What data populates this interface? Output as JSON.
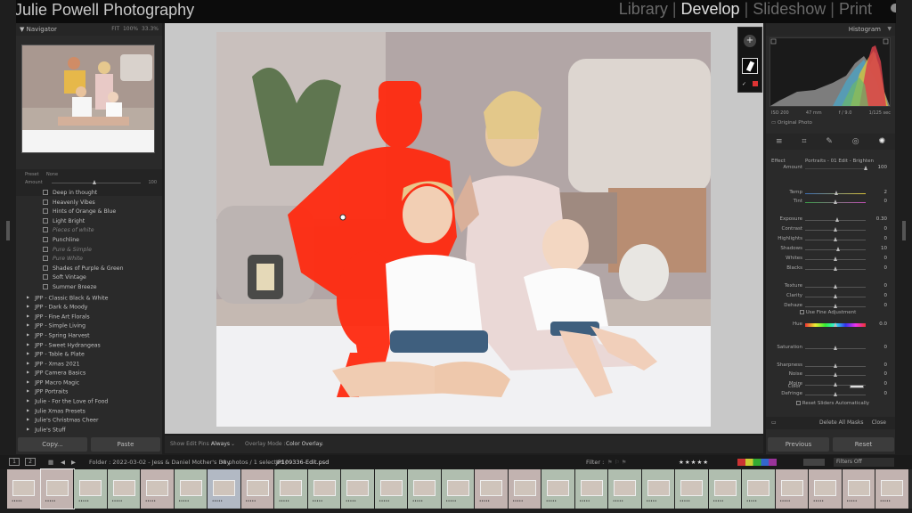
{
  "identity_plate": "Julie Powell Photography",
  "modules": [
    "Library",
    "Develop",
    "Slideshow",
    "Print"
  ],
  "active_module": "Develop",
  "navigator": {
    "title": "Navigator",
    "zoom": [
      "FIT",
      "100%",
      "33.3%"
    ]
  },
  "presets": {
    "header": [
      "Preset",
      "None"
    ],
    "amount_label": "Amount",
    "amount_value": "100",
    "items": [
      {
        "label": "Deep in thought",
        "type": "item"
      },
      {
        "label": "Heavenly Vibes",
        "type": "item"
      },
      {
        "label": "Hints of Orange & Blue",
        "type": "item"
      },
      {
        "label": "Light Bright",
        "type": "item"
      },
      {
        "label": "Pieces of white",
        "type": "item-it"
      },
      {
        "label": "Punchline",
        "type": "item"
      },
      {
        "label": "Pure & Simple",
        "type": "item-it"
      },
      {
        "label": "Pure White",
        "type": "item-it"
      },
      {
        "label": "Shades of Purple & Green",
        "type": "item"
      },
      {
        "label": "Soft Vintage",
        "type": "item"
      },
      {
        "label": "Summer Breeze",
        "type": "item"
      },
      {
        "label": "JPP - Classic Black & White",
        "type": "folder"
      },
      {
        "label": "JPP - Dark & Moody",
        "type": "folder"
      },
      {
        "label": "JPP - Fine Art Florals",
        "type": "folder"
      },
      {
        "label": "JPP - Simple Living",
        "type": "folder"
      },
      {
        "label": "JPP - Spring Harvest",
        "type": "folder"
      },
      {
        "label": "JPP - Sweet Hydrangeas",
        "type": "folder"
      },
      {
        "label": "JPP - Table & Plate",
        "type": "folder"
      },
      {
        "label": "JPP - Xmas 2021",
        "type": "folder"
      },
      {
        "label": "JPP Camera Basics",
        "type": "folder"
      },
      {
        "label": "JPP Macro Magic",
        "type": "folder"
      },
      {
        "label": "JPP Portraits",
        "type": "folder"
      },
      {
        "label": "Julie - For the Love of Food",
        "type": "folder"
      },
      {
        "label": "Julie Xmas Presets",
        "type": "folder"
      },
      {
        "label": "Julie's Christmas Cheer",
        "type": "folder"
      },
      {
        "label": "Julie's Stuff",
        "type": "folder"
      }
    ]
  },
  "left_buttons": {
    "copy": "Copy...",
    "paste": "Paste"
  },
  "toolbar": {
    "show_edit_pins_label": "Show Edit Pins :",
    "show_edit_pins_value": "Always",
    "overlay_mode_label": "Overlay Mode :",
    "overlay_mode_value": "Color Overlay"
  },
  "histogram": {
    "title": "Histogram",
    "info": [
      "ISO 200",
      "47 mm",
      "f / 9.0",
      "1/125 sec"
    ],
    "original_photo": "Original Photo"
  },
  "mask_panel": {
    "effect_label": "Effect",
    "effect_value": "Portraits - 01 Edit - Brighten",
    "sliders": [
      {
        "label": "Amount",
        "value": "100",
        "pos": 1.0
      },
      {
        "label": "Temp",
        "value": "2",
        "pos": 0.52
      },
      {
        "label": "Tint",
        "value": "0",
        "pos": 0.5
      },
      {
        "label": "Exposure",
        "value": "0.30",
        "pos": 0.53
      },
      {
        "label": "Contrast",
        "value": "0",
        "pos": 0.5
      },
      {
        "label": "Highlights",
        "value": "0",
        "pos": 0.5
      },
      {
        "label": "Shadows",
        "value": "10",
        "pos": 0.55
      },
      {
        "label": "Whites",
        "value": "0",
        "pos": 0.5
      },
      {
        "label": "Blacks",
        "value": "0",
        "pos": 0.5
      },
      {
        "label": "Texture",
        "value": "0",
        "pos": 0.5
      },
      {
        "label": "Clarity",
        "value": "0",
        "pos": 0.5
      },
      {
        "label": "Dehaze",
        "value": "0",
        "pos": 0.5
      },
      {
        "label": "Hue",
        "value": "0.0",
        "pos": 0.5
      },
      {
        "label": "Saturation",
        "value": "0",
        "pos": 0.5
      },
      {
        "label": "Sharpness",
        "value": "0",
        "pos": 0.5
      },
      {
        "label": "Noise",
        "value": "0",
        "pos": 0.5
      },
      {
        "label": "Moire",
        "value": "0",
        "pos": 0.5
      },
      {
        "label": "Defringe",
        "value": "0",
        "pos": 0.5
      }
    ],
    "use_fine_adjustment": "Use Fine Adjustment",
    "color_label": "Color",
    "reset_sliders": "Reset Sliders Automatically",
    "delete_all_masks": "Delete All Masks",
    "close": "Close"
  },
  "right_buttons": {
    "previous": "Previous",
    "reset": "Reset"
  },
  "filmstrip_bar": {
    "views": [
      "1",
      "2"
    ],
    "source": "Folder : 2022-03-02 - Jess & Daniel Mother's Day",
    "count": "38 photos / 1 selected /",
    "filename": "JP109336-Edit.psd",
    "filter_label": "Filter :",
    "filters_off": "Filters Off"
  },
  "colors": {
    "mask": "#ff2a10",
    "accent": "#e0e0e0",
    "background": "#1e1e1e"
  }
}
